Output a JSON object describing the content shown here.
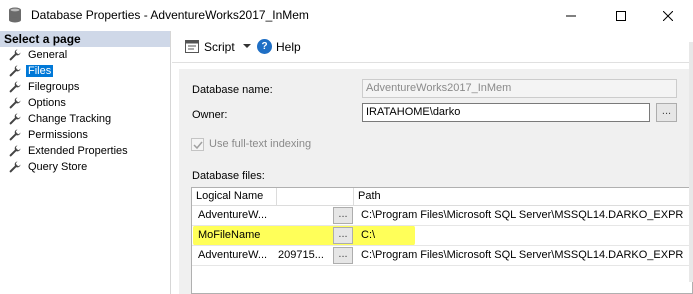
{
  "window": {
    "title": "Database Properties - AdventureWorks2017_InMem",
    "controls": [
      "minimize-icon",
      "maximize-icon",
      "close-icon"
    ]
  },
  "sidebar": {
    "header": "Select a page",
    "items": [
      {
        "label": "General",
        "icon": "wrench-icon",
        "active": false
      },
      {
        "label": "Files",
        "icon": "wrench-icon",
        "active": true
      },
      {
        "label": "Filegroups",
        "icon": "wrench-icon",
        "active": false
      },
      {
        "label": "Options",
        "icon": "wrench-icon",
        "active": false
      },
      {
        "label": "Change Tracking",
        "icon": "wrench-icon",
        "active": false
      },
      {
        "label": "Permissions",
        "icon": "wrench-icon",
        "active": false
      },
      {
        "label": "Extended Properties",
        "icon": "wrench-icon",
        "active": false
      },
      {
        "label": "Query Store",
        "icon": "wrench-icon",
        "active": false
      }
    ]
  },
  "toolbar": {
    "script_label": "Script",
    "help_label": "Help"
  },
  "form": {
    "db_name_label": "Database name:",
    "db_name_value": "AdventureWorks2017_InMem",
    "owner_label": "Owner:",
    "owner_value": "IRATAHOME\\darko",
    "browse_label": "...",
    "fulltext_label": "Use full-text indexing",
    "fulltext_checked": true,
    "db_files_label": "Database files:"
  },
  "grid": {
    "columns": [
      "Logical Name",
      "",
      "Path"
    ],
    "rows": [
      {
        "logical_name": "AdventureW...",
        "size": "",
        "browse": "...",
        "path": "C:\\Program Files\\Microsoft SQL Server\\MSSQL14.DARKO_EXPR"
      },
      {
        "logical_name": "MoFileName",
        "size": "",
        "browse": "...",
        "path": "C:\\"
      },
      {
        "logical_name": "AdventureW...",
        "size": "209715...",
        "browse": "...",
        "path": "C:\\Program Files\\Microsoft SQL Server\\MSSQL14.DARKO_EXPR"
      }
    ]
  },
  "colors": {
    "selection": "#0078d7",
    "highlight": "#ffff3c",
    "header_band": "#cfd8e8",
    "help_icon": "#1f6fc5"
  }
}
